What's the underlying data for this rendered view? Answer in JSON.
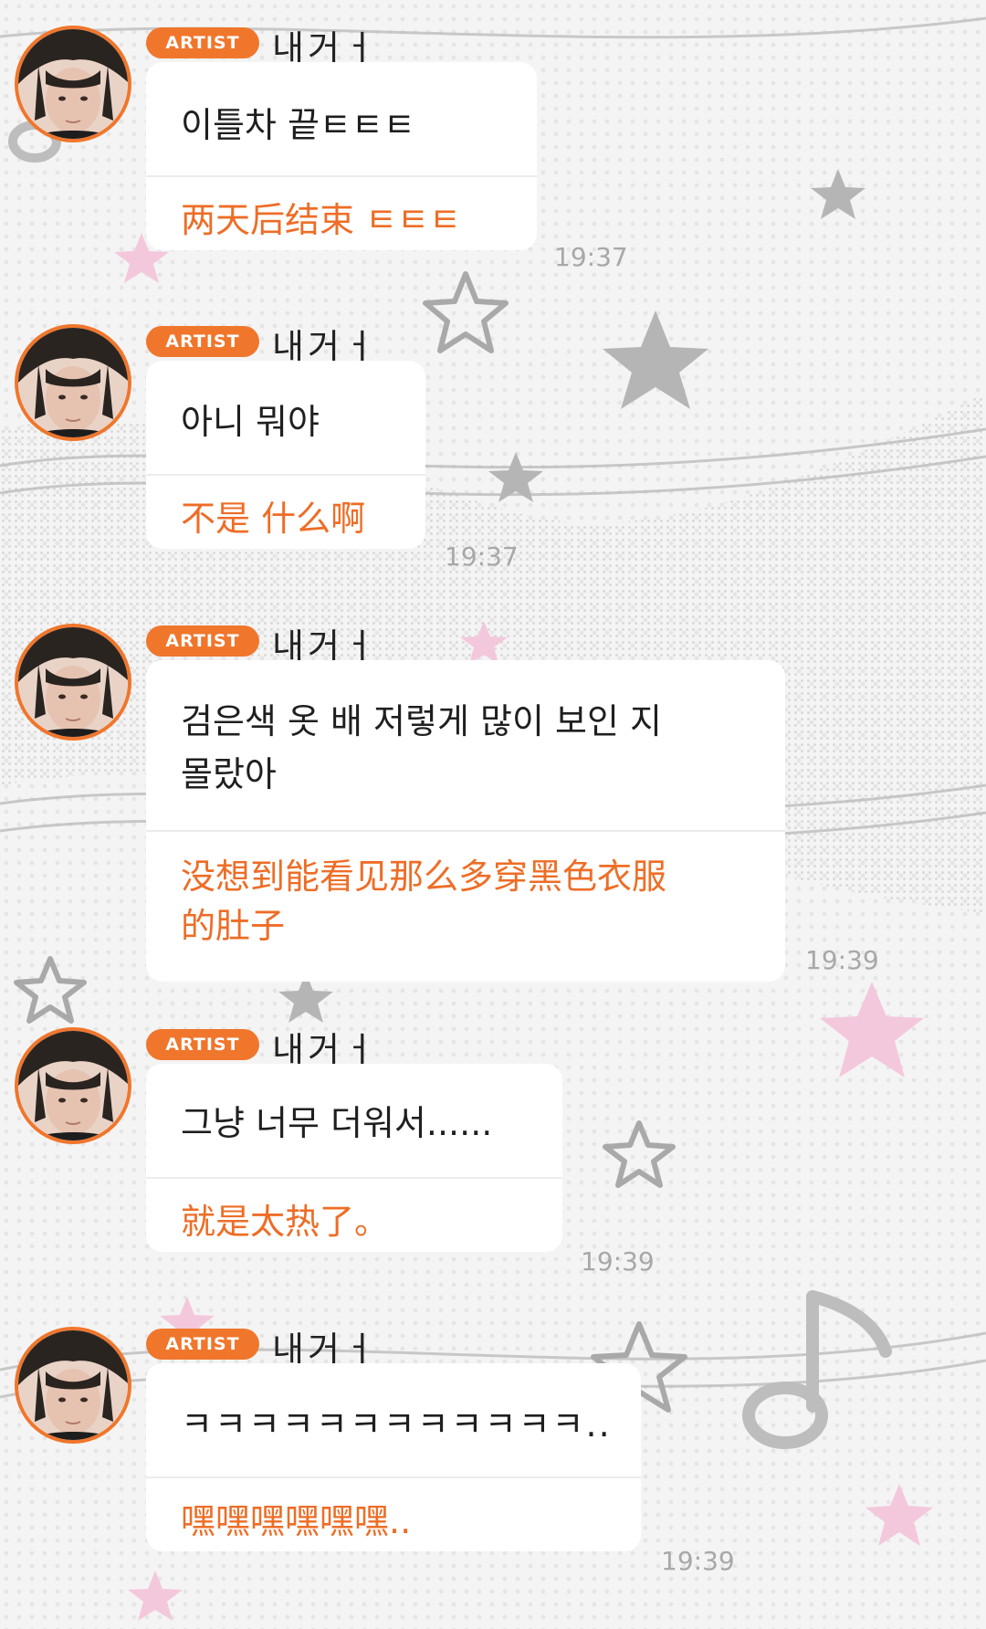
{
  "colors": {
    "accent": "#f0762c",
    "translation": "#ee6d26",
    "background": "#f4f4f4"
  },
  "messages": [
    {
      "badge": "ARTIST",
      "sender": "내거ㅓ",
      "korean": "이틀차 끝ㅌㅌㅌ",
      "chinese": "两天后结束 ㅌㅌㅌ",
      "time": "19:37"
    },
    {
      "badge": "ARTIST",
      "sender": "내거ㅓ",
      "korean": "아니 뭐야",
      "chinese": "不是 什么啊",
      "time": "19:37"
    },
    {
      "badge": "ARTIST",
      "sender": "내거ㅓ",
      "korean": "검은색 옷 배 저렇게 많이 보인 지\n몰랐아",
      "chinese": "没想到能看见那么多穿黑色衣服\n的肚子",
      "time": "19:39"
    },
    {
      "badge": "ARTIST",
      "sender": "내거ㅓ",
      "korean": "그냥 너무 더워서......",
      "chinese": "就是太热了。",
      "time": "19:39"
    },
    {
      "badge": "ARTIST",
      "sender": "내거ㅓ",
      "korean": "ㅋㅋㅋㅋㅋㅋㅋㅋㅋㅋㅋㅋ..",
      "chinese": "嘿嘿嘿嘿嘿嘿..",
      "time": "19:39"
    }
  ],
  "icons": {
    "avatar": "profile-photo",
    "background": "stars-music-notes-pattern"
  }
}
